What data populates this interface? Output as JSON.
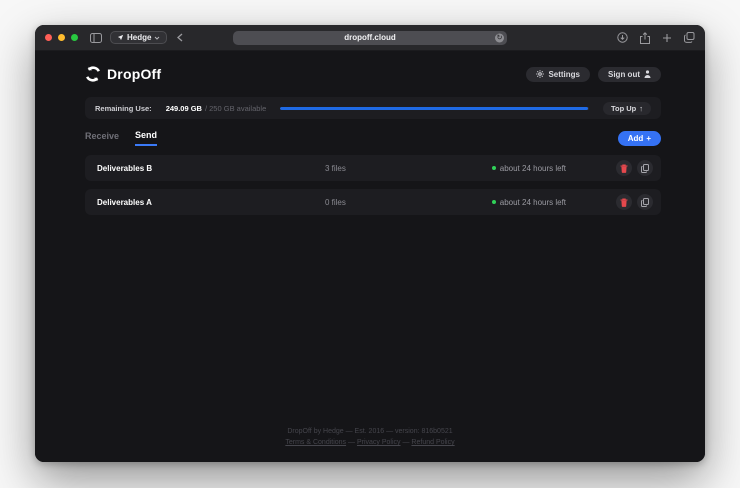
{
  "browser": {
    "profile_button": "Hedge",
    "url": "dropoff.cloud"
  },
  "header": {
    "app_name": "DropOff",
    "settings_label": "Settings",
    "signout_label": "Sign out"
  },
  "storage": {
    "label": "Remaining Use:",
    "used": "249.09 GB",
    "total_suffix": "/ 250 GB available",
    "topup_label": "Top Up",
    "topup_arrow": "↑",
    "progress_style": "width:99.6%"
  },
  "tabs": {
    "receive": "Receive",
    "send": "Send"
  },
  "add_button": {
    "label": "Add",
    "plus": "+"
  },
  "transfers": [
    {
      "name": "Deliverables B",
      "files": "3 files",
      "status": "about 24 hours left"
    },
    {
      "name": "Deliverables A",
      "files": "0 files",
      "status": "about 24 hours left"
    }
  ],
  "footer": {
    "line1": "DropOff by Hedge — Est. 2016 — version: 816b0521",
    "links": [
      "Terms & Conditions",
      "Privacy Policy",
      "Refund Policy"
    ],
    "separator": " — "
  },
  "colors": {
    "accent_blue": "#3572f4",
    "progress_blue": "#1f6ae5",
    "status_green": "#30d158",
    "danger_red": "#e5484d"
  }
}
